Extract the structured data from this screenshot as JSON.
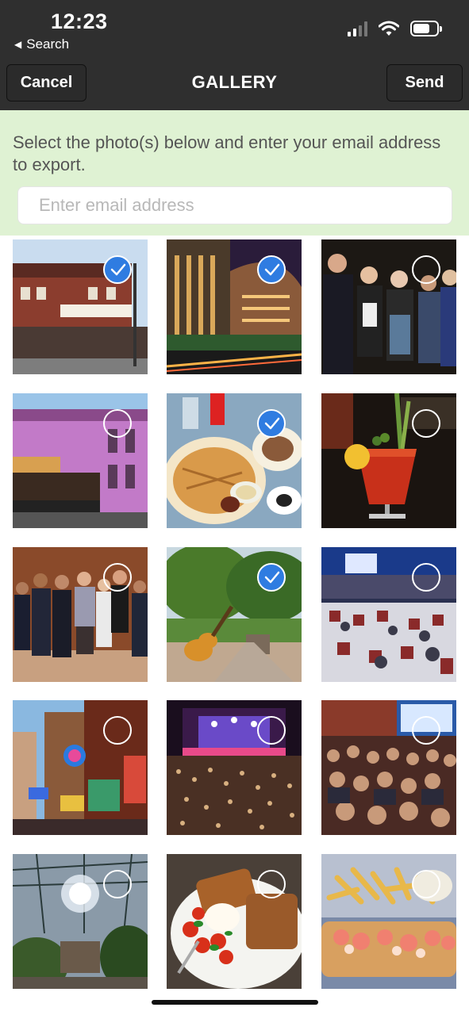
{
  "status": {
    "time": "12:23",
    "back": "Search"
  },
  "nav": {
    "cancel": "Cancel",
    "title": "GALLERY",
    "send": "Send"
  },
  "panel": {
    "instructions": "Select the photo(s) below and enter your email address to export.",
    "email_placeholder": "Enter email address",
    "email_value": ""
  },
  "colors": {
    "nav_bg": "#2f2f2f",
    "panel_bg": "#dff2d3",
    "check_blue": "#2f7ce1"
  },
  "photos": [
    {
      "icon": "photo-museum-building",
      "selected": true
    },
    {
      "icon": "photo-modern-building-night",
      "selected": true
    },
    {
      "icon": "photo-people-party",
      "selected": false
    },
    {
      "icon": "photo-pink-building-street",
      "selected": false
    },
    {
      "icon": "photo-plates-of-food",
      "selected": true
    },
    {
      "icon": "photo-bloody-mary-drink",
      "selected": false
    },
    {
      "icon": "photo-group-portrait",
      "selected": false
    },
    {
      "icon": "photo-guitar-sculpture-park",
      "selected": true
    },
    {
      "icon": "photo-conference-room",
      "selected": false
    },
    {
      "icon": "photo-neon-street",
      "selected": false
    },
    {
      "icon": "photo-concert-dance-floor",
      "selected": false
    },
    {
      "icon": "photo-seated-audience",
      "selected": false
    },
    {
      "icon": "photo-glass-atrium-chandelier",
      "selected": false
    },
    {
      "icon": "photo-toast-and-tomatoes",
      "selected": false
    },
    {
      "icon": "photo-lobster-roll-fries",
      "selected": false
    }
  ]
}
